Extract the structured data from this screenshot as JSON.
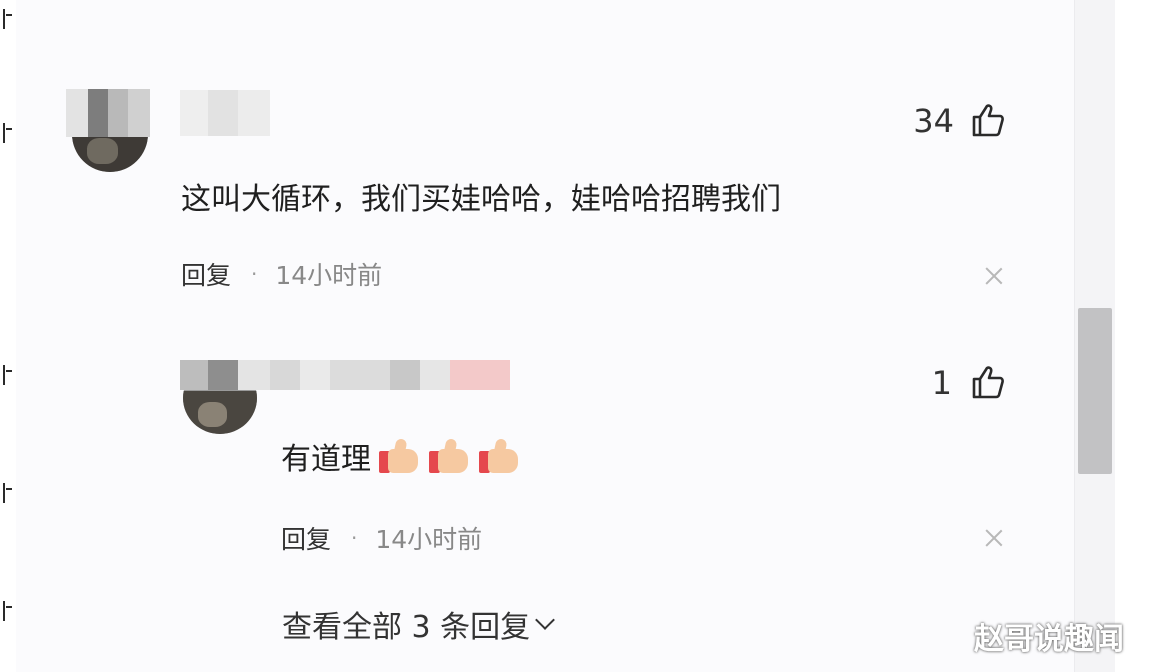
{
  "comments": [
    {
      "likes": "34",
      "text": "这叫大循环，我们买娃哈哈，娃哈哈招聘我们",
      "reply_label": "回复",
      "separator": "·",
      "time": "14小时前"
    },
    {
      "likes": "1",
      "text": "有道理",
      "emoji": [
        "thumbs-up-emoji",
        "thumbs-up-emoji",
        "thumbs-up-emoji"
      ],
      "reply_label": "回复",
      "separator": "·",
      "time": "14小时前"
    }
  ],
  "view_all_replies": "查看全部 3 条回复",
  "watermark": "赵哥说趣闻",
  "icons": {
    "like": "thumbs-up-outline-icon",
    "close": "close-icon",
    "expand": "chevron-down-icon"
  },
  "colors": {
    "background": "#fbfbfd",
    "text": "#1f1f1f",
    "meta": "#888888",
    "scroll_thumb": "#c2c2c4"
  }
}
